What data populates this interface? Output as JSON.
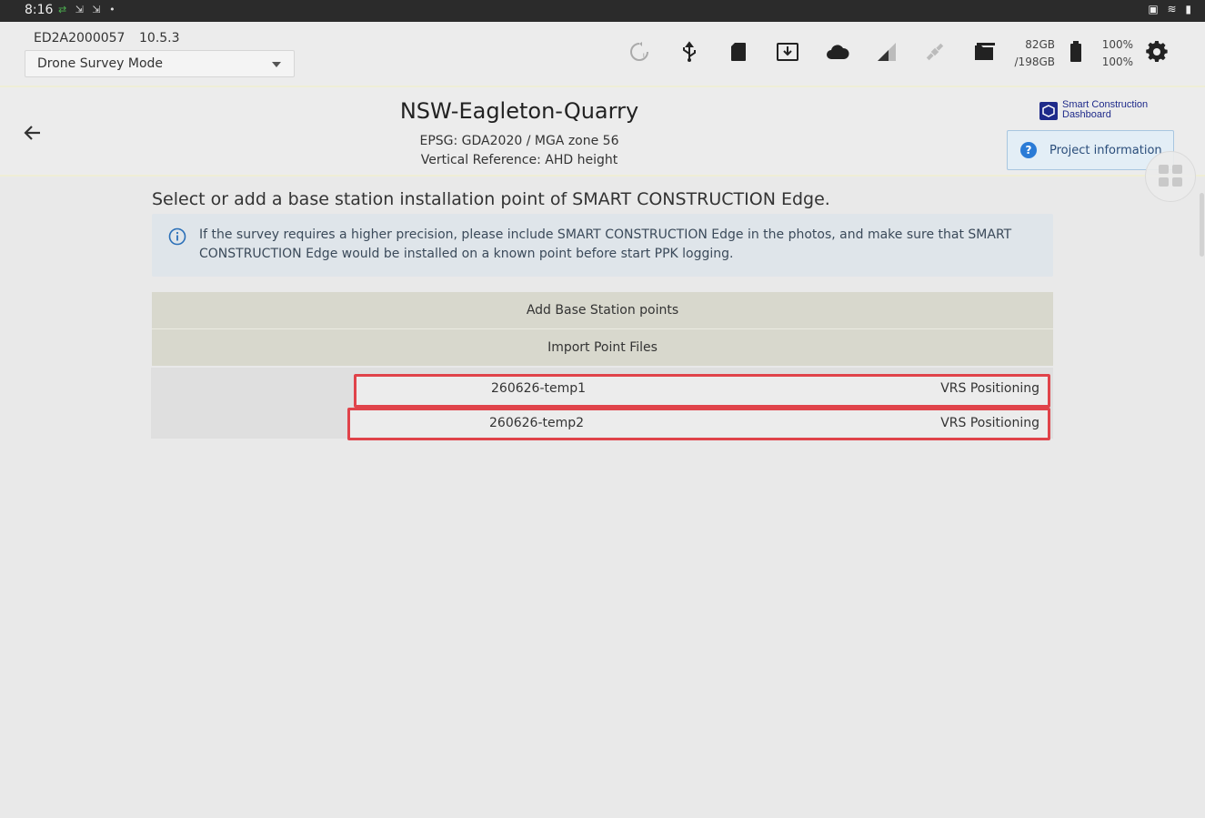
{
  "status_bar": {
    "time": "8:16"
  },
  "device": {
    "serial": "ED2A2000057",
    "version": "10.5.3",
    "mode_select": {
      "value": "Drone Survey Mode"
    },
    "storage": {
      "free": "82GB",
      "total": "/198GB"
    },
    "battery": {
      "pct1": "100%",
      "pct2": "100%"
    }
  },
  "project": {
    "title": "NSW-Eagleton-Quarry",
    "epsg": "EPSG: GDA2020 / MGA zone 56",
    "vertical_ref": "Vertical Reference: AHD height",
    "brand_line1": "Smart Construction",
    "brand_line2": "Dashboard",
    "info_button": "Project information"
  },
  "main": {
    "heading": "Select or add a base station installation point of SMART CONSTRUCTION Edge.",
    "info_text": "If the survey requires a higher precision, please include SMART CONSTRUCTION Edge in the photos, and make sure that SMART CONSTRUCTION Edge would be installed on a known point before start PPK logging.",
    "add_button": "Add Base Station points",
    "import_button": "Import Point Files",
    "points": [
      {
        "name": "260626-temp1",
        "method": "VRS Positioning"
      },
      {
        "name": "260626-temp2",
        "method": "VRS Positioning"
      }
    ]
  },
  "colors": {
    "highlight": "#e0434a",
    "accent": "#2a7bd6",
    "brand": "#1e2a8a"
  },
  "icons": [
    "back-arrow-icon",
    "sync-icon",
    "usb-icon",
    "sd-card-icon",
    "download-icon",
    "cloud-icon",
    "signal-icon",
    "satellite-icon",
    "folder-icon",
    "battery-icon",
    "gear-icon",
    "info-icon",
    "help-icon",
    "grid-icon"
  ]
}
